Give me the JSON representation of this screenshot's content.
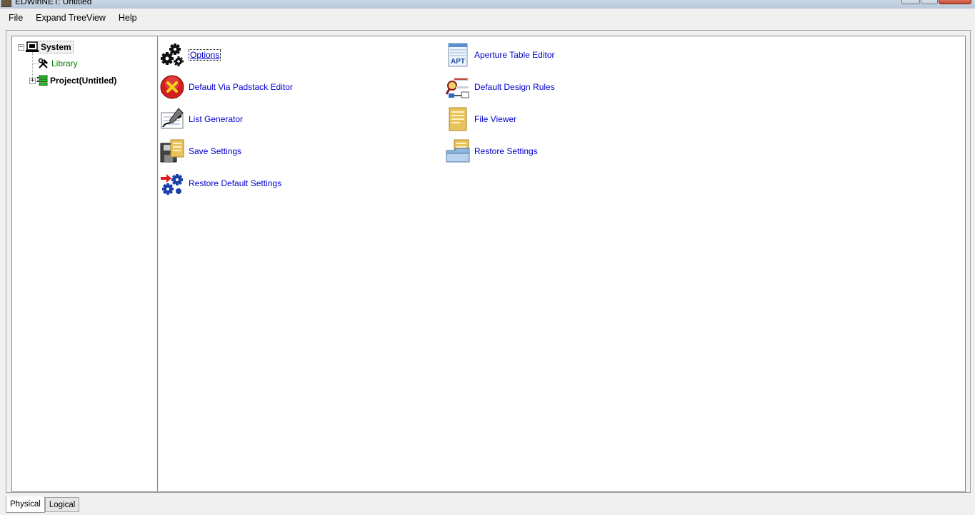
{
  "window": {
    "title": "EDWinNET: Untitled"
  },
  "menu": {
    "items": [
      "File",
      "Expand TreeView",
      "Help"
    ]
  },
  "tree": {
    "root": {
      "label": "System",
      "expander": "−",
      "icon": "system-icon"
    },
    "children": [
      {
        "label": "Library",
        "icon": "tools-icon",
        "color": "#008000"
      },
      {
        "label": "Project(Untitled)",
        "icon": "project-stack-icon",
        "expander": "+"
      }
    ]
  },
  "commands": [
    {
      "label": "Options",
      "icon": "gears-icon"
    },
    {
      "label": "Aperture Table Editor",
      "icon": "aperture-table-icon",
      "icon_text": "APT"
    },
    {
      "label": "Default Via Padstack Editor",
      "icon": "red-x-circle-icon"
    },
    {
      "label": "Default Design Rules",
      "icon": "design-rules-icon"
    },
    {
      "label": "List Generator",
      "icon": "list-generator-icon"
    },
    {
      "label": "File Viewer",
      "icon": "file-viewer-icon"
    },
    {
      "label": "Save Settings",
      "icon": "save-settings-icon"
    },
    {
      "label": "Restore Settings",
      "icon": "restore-settings-icon"
    },
    {
      "label": "Restore Default Settings",
      "icon": "restore-default-icon"
    }
  ],
  "tabs": [
    {
      "label": "Physical",
      "active": true
    },
    {
      "label": "Logical",
      "active": false
    }
  ],
  "colors": {
    "link": "#0000cd",
    "tree_green": "#008000"
  }
}
